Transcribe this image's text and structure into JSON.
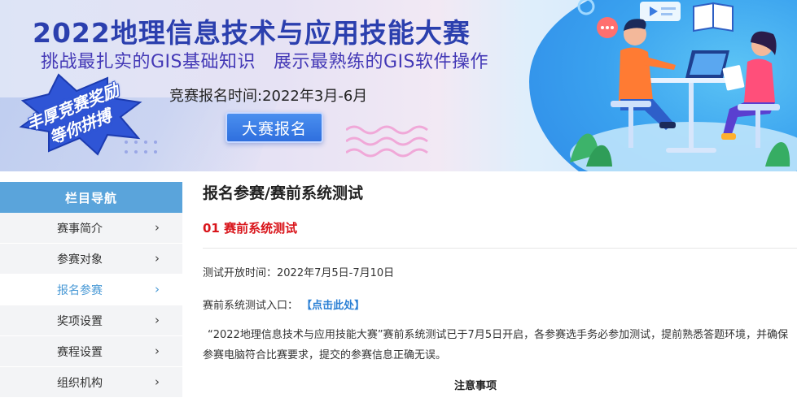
{
  "banner": {
    "title": "2022地理信息技术与应用技能大赛",
    "slogan_left": "挑战最扎实的GIS基础知识",
    "slogan_right": "展示最熟练的GIS软件操作",
    "registration_time": "竞赛报名时间:2022年3月-6月",
    "register_button": "大赛报名",
    "badge_line1": "丰厚竞赛奖励",
    "badge_line2": "等你拼搏"
  },
  "sidebar": {
    "header": "栏目导航",
    "items": [
      {
        "label": "赛事简介",
        "active": false
      },
      {
        "label": "参赛对象",
        "active": false
      },
      {
        "label": "报名参赛",
        "active": true
      },
      {
        "label": "奖项设置",
        "active": false
      },
      {
        "label": "赛程设置",
        "active": false
      },
      {
        "label": "组织机构",
        "active": false
      }
    ],
    "chevron": "›"
  },
  "content": {
    "heading": "报名参赛/赛前系统测试",
    "section_title": "01 赛前系统测试",
    "test_time": "测试开放时间：2022年7月5日-7月10日",
    "entry_label": "赛前系统测试入口：",
    "entry_link": "【点击此处】",
    "paragraph": "“2022地理信息技术与应用技能大赛”赛前系统测试已于7月5日开启，各参赛选手务必参加测试，提前熟悉答题环境，并确保参赛电脑符合比赛要求，提交的参赛信息正确无误。",
    "notice_title": "注意事项"
  },
  "colors": {
    "sidebar_header": "#5aa4db",
    "active_item": "#4a9ad6",
    "section_red": "#d9151b",
    "link_blue": "#2a7fd4",
    "title_blue": "#2b3fae"
  }
}
